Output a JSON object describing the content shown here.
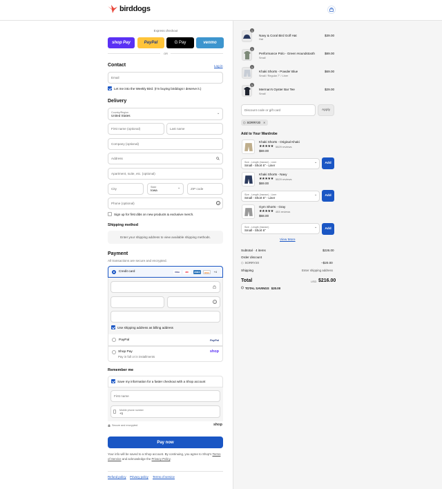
{
  "brand": {
    "name": "birddogs",
    "accent": "#1a56c4",
    "logo_color": "#e8473a"
  },
  "express": {
    "label": "Express checkout",
    "buttons": [
      {
        "label": "shop Pay",
        "bg": "#5a31f4",
        "color": "#ffffff"
      },
      {
        "label": "PayPal",
        "bg": "#ffc439",
        "color": "#253b80"
      },
      {
        "label": "G Pay",
        "bg": "#000000",
        "color": "#ffffff"
      },
      {
        "label": "venmo",
        "bg": "#3d95ce",
        "color": "#ffffff"
      }
    ],
    "or": "OR"
  },
  "contact": {
    "title": "Contact",
    "login": "Log in",
    "email_placeholder": "Email",
    "newsletter": "Let me into the Weekly Bird. (I'm buying birddogs I deserve it.)"
  },
  "delivery": {
    "title": "Delivery",
    "country_label": "Country/Region",
    "country_value": "United States",
    "first_name": "First name (optional)",
    "last_name": "Last name",
    "company": "Company (optional)",
    "address": "Address",
    "apartment": "Apartment, suite, etc. (optional)",
    "city": "City",
    "state_label": "State",
    "state_value": "Iowa",
    "zip": "ZIP code",
    "phone": "Phone (optional)",
    "sms_signup": "Sign up for first dibs on new products & exclusive merch."
  },
  "shipping": {
    "title": "Shipping method",
    "message": "Enter your shipping address to view available shipping methods."
  },
  "payment": {
    "title": "Payment",
    "subtitle": "All transactions are secure and encrypted.",
    "credit_card": "Credit card",
    "card_brands": [
      "VISA",
      "MC",
      "AMEX",
      "DISC"
    ],
    "more_cards": "+4",
    "billing_same": "Use shipping address as billing address",
    "paypal": "PayPal",
    "paypal_logo": "PayPal",
    "shop_pay": "Shop Pay",
    "shop_pay_sub": "Pay in full or in installments",
    "shop_logo": "shop"
  },
  "remember": {
    "title": "Remember me",
    "save_info": "Save my information for a faster checkout with a Shop account",
    "first_name": "First name",
    "mobile_label": "Mobile phone number",
    "mobile_value": "+1",
    "secure": "Secure and encrypted",
    "shop": "shop"
  },
  "pay_now": "Pay now",
  "legal": {
    "text1": "Your info will be saved to a Shop account. By continuing, you agree to Shop's",
    "tos": "Terms of Service",
    "text2": "and acknowledge the",
    "privacy": "Privacy Policy",
    "end": "."
  },
  "footer_links": [
    "Refund policy",
    "Privacy policy",
    "Terms of service"
  ],
  "cart": {
    "items": [
      {
        "qty": "1",
        "name": "Navy & Coral Bird Golf Hat",
        "variant": "Hat",
        "price": "$39.00"
      },
      {
        "qty": "1",
        "name": "Performance Polo - Green Houndstooth",
        "variant": "Small",
        "price": "$89.00"
      },
      {
        "qty": "1",
        "name": "Khaki Shorts - Powder Blue",
        "variant": "Small / Regular 7\" / Liner",
        "price": "$69.00"
      },
      {
        "qty": "1",
        "name": "Merman's Oyster Bar Tee",
        "variant": "Small",
        "price": "$29.00"
      }
    ],
    "discount_placeholder": "Discount code or gift card",
    "apply": "Apply",
    "discount_tag": "SORRY20"
  },
  "wardrobe": {
    "title": "Add to Your Wardrobe",
    "products": [
      {
        "name": "Khaki Shorts - Original Khaki",
        "stars": "★★★★★",
        "reviews": "5529 reviews",
        "price": "$69.00",
        "select_label": "Size - Length (Inseam) - Liner",
        "select_value": "Small - Short 6\" - Liner",
        "add": "Add"
      },
      {
        "name": "Khaki Shorts - Navy",
        "stars": "★★★★★",
        "reviews": "5529 reviews",
        "price": "$69.00",
        "select_label": "Size - Length (Inseam) - Liner",
        "select_value": "Small - Short 6\" - Liner",
        "add": "Add"
      },
      {
        "name": "Gym Shorts - Gray",
        "stars": "★★★★★",
        "reviews": "453 reviews",
        "price": "$68.00",
        "select_label": "Size - Length (Inseam)",
        "select_value": "Small - Short 6\"",
        "add": "Add"
      }
    ],
    "view_more": "View More"
  },
  "summary": {
    "subtotal_label": "Subtotal · 4 items",
    "subtotal_value": "$226.00",
    "order_discount": "Order discount",
    "code": "SORRY20",
    "discount_value": "−$20.00",
    "shipping_label": "Shipping",
    "shipping_value": "Enter shipping address",
    "total_label": "Total",
    "currency": "USD",
    "total_value": "$216.00",
    "savings_label": "TOTAL SAVINGS",
    "savings_value": "$20.00"
  }
}
